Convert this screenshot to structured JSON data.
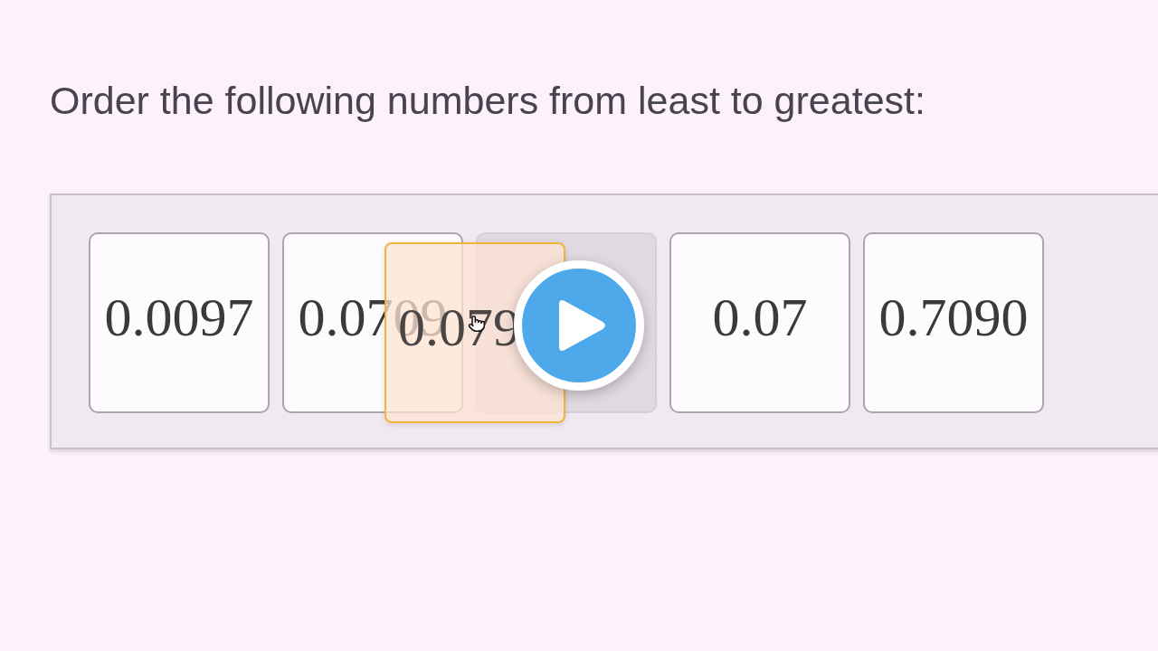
{
  "prompt": "Order the following numbers from least to greatest:",
  "tray": {
    "slots": [
      {
        "kind": "card",
        "value": "0.0097"
      },
      {
        "kind": "card",
        "value": "0.0709"
      },
      {
        "kind": "placeholder"
      },
      {
        "kind": "card",
        "value": "0.07"
      },
      {
        "kind": "card",
        "value": "0.7090"
      }
    ]
  },
  "dragged_card": {
    "value": "0.079"
  }
}
